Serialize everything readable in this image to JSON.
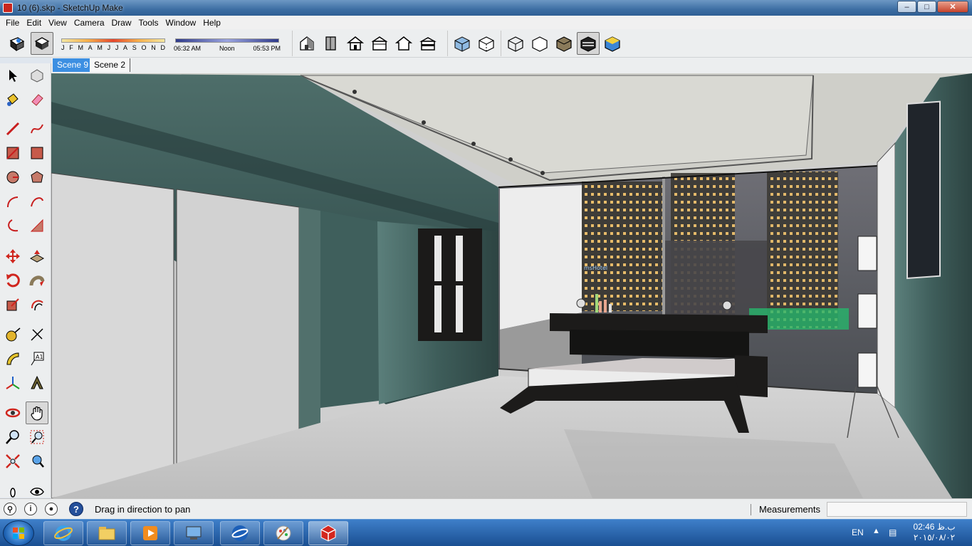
{
  "window": {
    "title": "10 (6).skp - SketchUp Make",
    "minimize_glyph": "–",
    "maximize_glyph": "□",
    "close_glyph": "✕"
  },
  "menu": [
    "File",
    "Edit",
    "View",
    "Camera",
    "Draw",
    "Tools",
    "Window",
    "Help"
  ],
  "shadow_settings": {
    "months": [
      "J",
      "F",
      "M",
      "A",
      "M",
      "J",
      "J",
      "A",
      "S",
      "O",
      "N",
      "D"
    ],
    "time_start": "06:32 AM",
    "time_mid": "Noon",
    "time_end": "05:53 PM"
  },
  "scene_tabs": [
    {
      "label": "Scene 9",
      "active": true
    },
    {
      "label": "Scene 2",
      "active": false
    }
  ],
  "viewport": {
    "sign_text": "msHotel"
  },
  "status": {
    "message": "Drag in direction to pan",
    "help_glyph": "?",
    "measurements_label": "Measurements",
    "measurements_value": ""
  },
  "taskbar": {
    "language": "EN",
    "time": "02:46 ب.ظ",
    "date": "٢٠١٥/٠٨/٠٢"
  },
  "colors": {
    "accent_tab": "#3c8fe2",
    "taskbar": "#1a4f92",
    "wall_texture": "#3f5f5c",
    "floor": "#c9c9c9"
  }
}
